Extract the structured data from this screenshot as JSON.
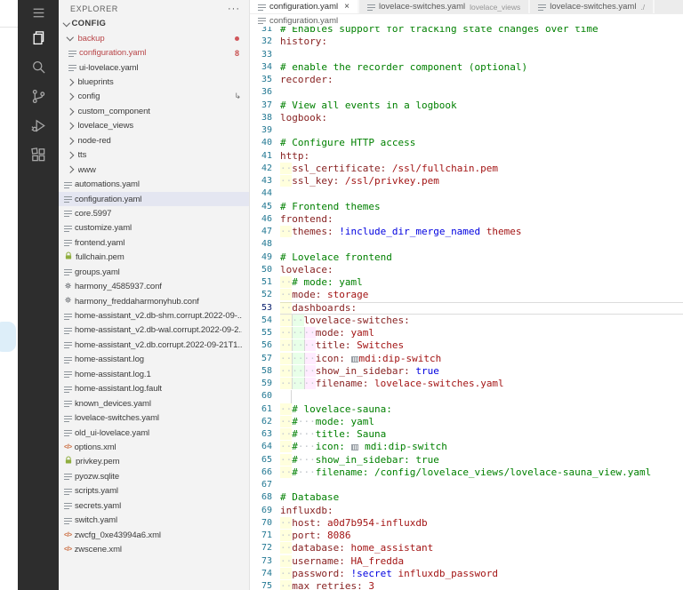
{
  "colors": {
    "activity_bar_bg": "#2d2d2d",
    "sidebar_bg": "#f3f3f3",
    "editor_bg": "#ffffff",
    "tab_inactive_bg": "#ececec",
    "selection_row_bg": "#e4e6f1",
    "error_item": "#b9474a",
    "badge_red": "#c94f4f",
    "comment": "#008000",
    "yaml_key": "#882222",
    "yaml_value": "#a31515",
    "yaml_keyword": "#0000e0",
    "line_number": "#237893",
    "active_line_number": "#0b216f",
    "current_line_border": "#dcdcdc",
    "pem_lock_green": "#8fae3e",
    "xml_icon_orange": "#c9683a"
  },
  "activity_bar": {
    "items": [
      {
        "name": "menu",
        "icon": "menu-icon",
        "active": false
      },
      {
        "name": "explorer",
        "icon": "files-icon",
        "active": true
      },
      {
        "name": "search",
        "icon": "search-icon",
        "active": false
      },
      {
        "name": "source-control",
        "icon": "branch-icon",
        "active": false
      },
      {
        "name": "run-debug",
        "icon": "play-bug-icon",
        "active": false
      },
      {
        "name": "extensions",
        "icon": "extensions-icon",
        "active": false
      }
    ]
  },
  "explorer": {
    "title": "EXPLORER",
    "actions": "···",
    "section": "CONFIG",
    "tree": [
      {
        "label": "backup",
        "kind": "folder",
        "expanded": true,
        "error": true,
        "badge": "dot"
      },
      {
        "label": "configuration.yaml",
        "kind": "file",
        "icon": "lines",
        "level": 2,
        "error": true,
        "badge": "8"
      },
      {
        "label": "ui-lovelace.yaml",
        "kind": "file",
        "icon": "lines",
        "level": 2
      },
      {
        "label": "blueprints",
        "kind": "folder",
        "expanded": false
      },
      {
        "label": "config",
        "kind": "folder",
        "expanded": false,
        "trailing": "symlink-arrow"
      },
      {
        "label": "custom_component",
        "kind": "folder",
        "expanded": false
      },
      {
        "label": "lovelace_views",
        "kind": "folder",
        "expanded": false
      },
      {
        "label": "node-red",
        "kind": "folder",
        "expanded": false
      },
      {
        "label": "tts",
        "kind": "folder",
        "expanded": false
      },
      {
        "label": "www",
        "kind": "folder",
        "expanded": false
      },
      {
        "label": "automations.yaml",
        "kind": "file",
        "icon": "lines",
        "level": 1
      },
      {
        "label": "configuration.yaml",
        "kind": "file",
        "icon": "lines",
        "level": 1,
        "selected": true
      },
      {
        "label": "core.5997",
        "kind": "file",
        "icon": "lines",
        "level": 1
      },
      {
        "label": "customize.yaml",
        "kind": "file",
        "icon": "lines",
        "level": 1
      },
      {
        "label": "frontend.yaml",
        "kind": "file",
        "icon": "lines",
        "level": 1
      },
      {
        "label": "fullchain.pem",
        "kind": "file",
        "icon": "lock",
        "level": 1
      },
      {
        "label": "groups.yaml",
        "kind": "file",
        "icon": "lines",
        "level": 1
      },
      {
        "label": "harmony_4585937.conf",
        "kind": "file",
        "icon": "gear",
        "level": 1
      },
      {
        "label": "harmony_freddaharmonyhub.conf",
        "kind": "file",
        "icon": "gear",
        "level": 1
      },
      {
        "label": "home-assistant_v2.db-shm.corrupt.2022-09-...",
        "kind": "file",
        "icon": "lines",
        "level": 1
      },
      {
        "label": "home-assistant_v2.db-wal.corrupt.2022-09-2...",
        "kind": "file",
        "icon": "lines",
        "level": 1
      },
      {
        "label": "home-assistant_v2.db.corrupt.2022-09-21T1...",
        "kind": "file",
        "icon": "lines",
        "level": 1
      },
      {
        "label": "home-assistant.log",
        "kind": "file",
        "icon": "lines",
        "level": 1
      },
      {
        "label": "home-assistant.log.1",
        "kind": "file",
        "icon": "lines",
        "level": 1
      },
      {
        "label": "home-assistant.log.fault",
        "kind": "file",
        "icon": "lines",
        "level": 1
      },
      {
        "label": "known_devices.yaml",
        "kind": "file",
        "icon": "lines",
        "level": 1
      },
      {
        "label": "lovelace-switches.yaml",
        "kind": "file",
        "icon": "lines",
        "level": 1
      },
      {
        "label": "old_ui-lovelace.yaml",
        "kind": "file",
        "icon": "lines",
        "level": 1
      },
      {
        "label": "options.xml",
        "kind": "file",
        "icon": "xml",
        "level": 1
      },
      {
        "label": "privkey.pem",
        "kind": "file",
        "icon": "lock",
        "level": 1
      },
      {
        "label": "pyozw.sqlite",
        "kind": "file",
        "icon": "lines",
        "level": 1
      },
      {
        "label": "scripts.yaml",
        "kind": "file",
        "icon": "lines",
        "level": 1
      },
      {
        "label": "secrets.yaml",
        "kind": "file",
        "icon": "lines",
        "level": 1
      },
      {
        "label": "switch.yaml",
        "kind": "file",
        "icon": "lines",
        "level": 1
      },
      {
        "label": "zwcfg_0xe43994a6.xml",
        "kind": "file",
        "icon": "xml",
        "level": 1
      },
      {
        "label": "zwscene.xml",
        "kind": "file",
        "icon": "xml",
        "level": 1
      }
    ]
  },
  "tabs": [
    {
      "label": "configuration.yaml",
      "description": "",
      "active": true,
      "close": "×"
    },
    {
      "label": "lovelace-switches.yaml",
      "description": "lovelace_views",
      "active": false
    },
    {
      "label": "lovelace-switches.yaml",
      "description": "./",
      "active": false
    }
  ],
  "breadcrumb": {
    "file": "configuration.yaml"
  },
  "editor": {
    "lines": [
      {
        "n": 31,
        "t": [
          [
            "cmt",
            "# Enables support for tracking state changes over time"
          ]
        ]
      },
      {
        "n": 32,
        "t": [
          [
            "key",
            "history:"
          ]
        ]
      },
      {
        "n": 33,
        "t": []
      },
      {
        "n": 34,
        "t": [
          [
            "cmt",
            "# enable the recorder component (optional)"
          ]
        ]
      },
      {
        "n": 35,
        "t": [
          [
            "key",
            "recorder:"
          ]
        ]
      },
      {
        "n": 36,
        "t": []
      },
      {
        "n": 37,
        "t": [
          [
            "cmt",
            "# View all events in a logbook"
          ]
        ]
      },
      {
        "n": 38,
        "t": [
          [
            "key",
            "logbook:"
          ]
        ]
      },
      {
        "n": 39,
        "t": []
      },
      {
        "n": 40,
        "t": [
          [
            "cmt",
            "# Configure HTTP access"
          ]
        ]
      },
      {
        "n": 41,
        "t": [
          [
            "key",
            "http:"
          ]
        ]
      },
      {
        "n": 42,
        "t": [
          [
            "ws",
            "  "
          ],
          [
            "key",
            "ssl_certificate:"
          ],
          [
            "sp",
            " "
          ],
          [
            "val",
            "/ssl/fullchain.pem"
          ]
        ]
      },
      {
        "n": 43,
        "t": [
          [
            "ws",
            "  "
          ],
          [
            "key",
            "ssl_key:"
          ],
          [
            "sp",
            " "
          ],
          [
            "val",
            "/ssl/privkey.pem"
          ]
        ]
      },
      {
        "n": 44,
        "t": []
      },
      {
        "n": 45,
        "t": [
          [
            "cmt",
            "# Frontend themes"
          ]
        ]
      },
      {
        "n": 46,
        "t": [
          [
            "key",
            "frontend:"
          ]
        ]
      },
      {
        "n": 47,
        "t": [
          [
            "ws",
            "  "
          ],
          [
            "key",
            "themes:"
          ],
          [
            "sp",
            " "
          ],
          [
            "kw",
            "!include_dir_merge_named"
          ],
          [
            "sp",
            " "
          ],
          [
            "val",
            "themes"
          ]
        ]
      },
      {
        "n": 48,
        "t": []
      },
      {
        "n": 49,
        "t": [
          [
            "cmt",
            "# Lovelace frontend"
          ]
        ]
      },
      {
        "n": 50,
        "t": [
          [
            "key",
            "lovelace:"
          ]
        ]
      },
      {
        "n": 51,
        "t": [
          [
            "ws",
            "  "
          ],
          [
            "cmt",
            "# mode: yaml"
          ]
        ]
      },
      {
        "n": 52,
        "t": [
          [
            "ws",
            "  "
          ],
          [
            "key",
            "mode:"
          ],
          [
            "sp",
            " "
          ],
          [
            "val",
            "storage"
          ]
        ]
      },
      {
        "n": 53,
        "a": 1,
        "t": [
          [
            "ws",
            "  "
          ],
          [
            "key",
            "dashboards:"
          ]
        ]
      },
      {
        "n": 54,
        "t": [
          [
            "ws",
            "    "
          ],
          [
            "key",
            "lovelace-switches:"
          ]
        ]
      },
      {
        "n": 55,
        "t": [
          [
            "ws",
            "      "
          ],
          [
            "key",
            "mode:"
          ],
          [
            "sp",
            " "
          ],
          [
            "val",
            "yaml"
          ]
        ]
      },
      {
        "n": 56,
        "t": [
          [
            "ws",
            "      "
          ],
          [
            "key",
            "title:"
          ],
          [
            "sp",
            " "
          ],
          [
            "val",
            "Switches"
          ]
        ]
      },
      {
        "n": 57,
        "t": [
          [
            "ws",
            "      "
          ],
          [
            "key",
            "icon:"
          ],
          [
            "sp",
            " "
          ],
          [
            "ico",
            ""
          ],
          [
            "val",
            "mdi:dip-switch"
          ]
        ]
      },
      {
        "n": 58,
        "t": [
          [
            "ws",
            "      "
          ],
          [
            "key",
            "show_in_sidebar:"
          ],
          [
            "sp",
            " "
          ],
          [
            "kw",
            "true"
          ]
        ]
      },
      {
        "n": 59,
        "t": [
          [
            "ws",
            "      "
          ],
          [
            "key",
            "filename:"
          ],
          [
            "sp",
            " "
          ],
          [
            "val",
            "lovelace-switches.yaml"
          ]
        ]
      },
      {
        "n": 60,
        "t": [
          [
            "g2",
            ""
          ]
        ]
      },
      {
        "n": 61,
        "t": [
          [
            "ws",
            "  "
          ],
          [
            "cmt",
            "# lovelace-sauna:"
          ]
        ]
      },
      {
        "n": 62,
        "t": [
          [
            "ws",
            "  "
          ],
          [
            "cmt",
            "#"
          ],
          [
            "dot",
            "   "
          ],
          [
            "cmt",
            "mode: yaml"
          ]
        ]
      },
      {
        "n": 63,
        "t": [
          [
            "ws",
            "  "
          ],
          [
            "cmt",
            "#"
          ],
          [
            "dot",
            "   "
          ],
          [
            "cmt",
            "title: Sauna"
          ]
        ]
      },
      {
        "n": 64,
        "t": [
          [
            "ws",
            "  "
          ],
          [
            "cmt",
            "#"
          ],
          [
            "dot",
            "   "
          ],
          [
            "cmt",
            "icon: "
          ],
          [
            "ico",
            ""
          ],
          [
            "cmt",
            " mdi:dip-switch"
          ]
        ]
      },
      {
        "n": 65,
        "t": [
          [
            "ws",
            "  "
          ],
          [
            "cmt",
            "#"
          ],
          [
            "dot",
            "   "
          ],
          [
            "cmt",
            "show_in_sidebar: true"
          ]
        ]
      },
      {
        "n": 66,
        "t": [
          [
            "ws",
            "  "
          ],
          [
            "cmt",
            "#"
          ],
          [
            "dot",
            "   "
          ],
          [
            "cmt",
            "filename: /config/lovelace_views/lovelace-sauna_view.yaml"
          ]
        ]
      },
      {
        "n": 67,
        "t": []
      },
      {
        "n": 68,
        "t": [
          [
            "cmt",
            "# Database"
          ]
        ]
      },
      {
        "n": 69,
        "t": [
          [
            "key",
            "influxdb:"
          ]
        ]
      },
      {
        "n": 70,
        "t": [
          [
            "ws",
            "  "
          ],
          [
            "key",
            "host:"
          ],
          [
            "sp",
            " "
          ],
          [
            "val",
            "a0d7b954-influxdb"
          ]
        ]
      },
      {
        "n": 71,
        "t": [
          [
            "ws",
            "  "
          ],
          [
            "key",
            "port:"
          ],
          [
            "sp",
            " "
          ],
          [
            "val",
            "8086"
          ]
        ]
      },
      {
        "n": 72,
        "t": [
          [
            "ws",
            "  "
          ],
          [
            "key",
            "database:"
          ],
          [
            "sp",
            " "
          ],
          [
            "val",
            "home_assistant"
          ]
        ]
      },
      {
        "n": 73,
        "t": [
          [
            "ws",
            "  "
          ],
          [
            "key",
            "username:"
          ],
          [
            "sp",
            " "
          ],
          [
            "val",
            "HA_fredda"
          ]
        ]
      },
      {
        "n": 74,
        "t": [
          [
            "ws",
            "  "
          ],
          [
            "key",
            "password:"
          ],
          [
            "sp",
            " "
          ],
          [
            "kw",
            "!secret"
          ],
          [
            "sp",
            " "
          ],
          [
            "val",
            "influxdb_password"
          ]
        ]
      },
      {
        "n": 75,
        "t": [
          [
            "ws",
            "  "
          ],
          [
            "key",
            "max_retries:"
          ],
          [
            "sp",
            " "
          ],
          [
            "val",
            "3"
          ]
        ]
      }
    ]
  }
}
